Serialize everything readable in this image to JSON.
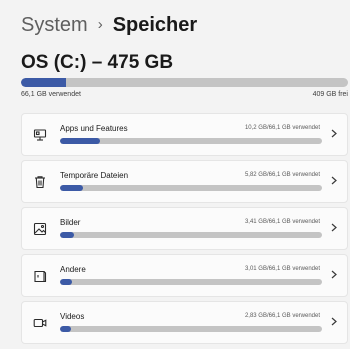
{
  "breadcrumb": {
    "parent": "System",
    "separator": "›",
    "current": "Speicher"
  },
  "drive": {
    "title": "OS (C:) – 475 GB",
    "used_label": "66,1 GB verwendet",
    "free_label": "409 GB frei",
    "used_fraction": 0.139,
    "accent": "#3c5aa6"
  },
  "categories": [
    {
      "label": "Apps und Features",
      "value": "10,2 GB/66,1 GB verwendet",
      "fraction": 0.154,
      "icon": "apps-features-icon"
    },
    {
      "label": "Temporäre Dateien",
      "value": "5,82 GB/66,1 GB verwendet",
      "fraction": 0.088,
      "icon": "trash-icon"
    },
    {
      "label": "Bilder",
      "value": "3,41 GB/66,1 GB verwendet",
      "fraction": 0.052,
      "icon": "image-icon"
    },
    {
      "label": "Andere",
      "value": "3,01 GB/66,1 GB verwendet",
      "fraction": 0.046,
      "icon": "other-icon"
    },
    {
      "label": "Videos",
      "value": "2,83 GB/66,1 GB verwendet",
      "fraction": 0.043,
      "icon": "video-icon"
    }
  ]
}
